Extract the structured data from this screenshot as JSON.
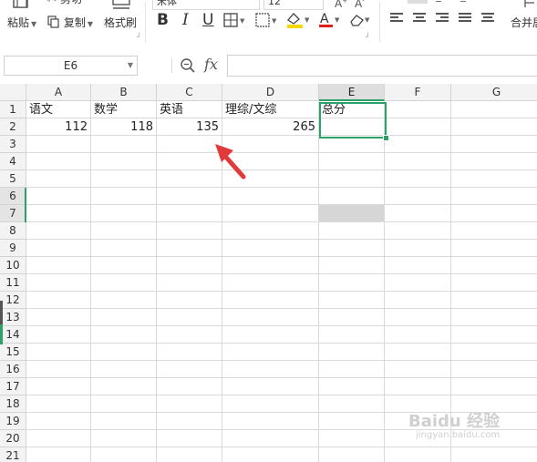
{
  "toolbar": {
    "cut_label": "剪切",
    "paste_label": "粘贴",
    "copy_label": "复制",
    "format_painter_label": "格式刷",
    "font_name": "宋体",
    "font_size": "12",
    "merge_label": "合并居",
    "font_color_hex": "#e02020",
    "highlight_hex": "#f5d800",
    "icons": [
      "paste-icon",
      "copy-icon",
      "format-painter-icon",
      "bold-icon",
      "italic-icon",
      "underline-icon",
      "border-icon",
      "fill-color-icon",
      "font-color-icon",
      "clear-icon",
      "align-left-icon",
      "align-center-icon",
      "align-right-icon",
      "justify-icon",
      "distribute-icon",
      "merge-icon"
    ]
  },
  "formula_bar": {
    "name_box": "E6",
    "fx_label": "fx",
    "value": ""
  },
  "sheet": {
    "columns": [
      "A",
      "B",
      "C",
      "D",
      "E",
      "F",
      "G"
    ],
    "selected_column": "E",
    "rows": [
      "1",
      "2",
      "3",
      "4",
      "5",
      "6",
      "7",
      "8",
      "9",
      "10",
      "11",
      "12",
      "13",
      "14",
      "15",
      "16",
      "17",
      "18",
      "19",
      "20",
      "21"
    ],
    "selected_rows": [
      "6",
      "7"
    ],
    "header_row": {
      "A": "语文",
      "B": "数学",
      "C": "英语",
      "D": "理综/文综",
      "E": "总分"
    },
    "data_row": {
      "A": "112",
      "B": "118",
      "C": "135",
      "D": "265"
    },
    "accent_hex": "#2ea069"
  },
  "annotation": {
    "arrow_color": "#e23a3a"
  },
  "watermark": {
    "text": "Baidu 经验",
    "sub": "jingyan.baidu.com"
  }
}
